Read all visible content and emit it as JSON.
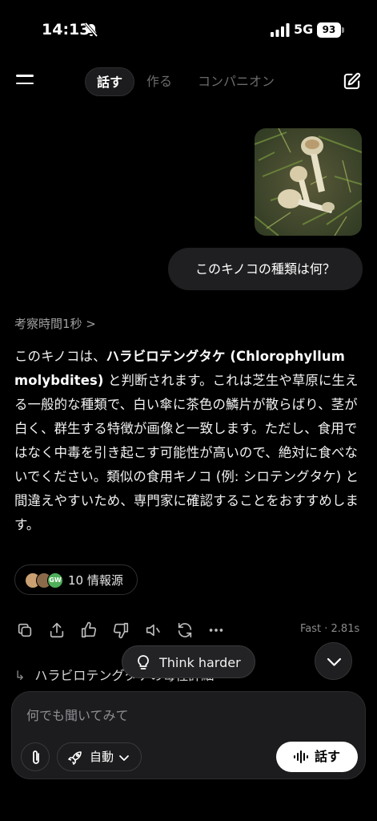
{
  "status_bar": {
    "time": "14:13",
    "network": "5G",
    "battery": "93"
  },
  "nav": {
    "tabs": [
      {
        "label": "話す",
        "active": true
      },
      {
        "label": "作る",
        "active": false
      },
      {
        "label": "コンパニオン",
        "active": false
      }
    ]
  },
  "conversation": {
    "user_message": "このキノコの種類は何？",
    "thought_label": "考察時間1秒 >",
    "answer": {
      "intro": "このキノコは、",
      "name_bold": "ハラビロテングタケ (Chlorophyllum molybdites)",
      "body": " と判断されます。これは芝生や草原に生える一般的な種類で、白い傘に茶色の鱗片が散らばり、茎が白く、群生する特徴が画像と一致します。ただし、食用ではなく中毒を引き起こす可能性が高いので、絶対に食べないでください。類似の食用キノコ (例: シロテングタケ) と間違えやすいため、専門家に確認することをおすすめします。"
    },
    "sources_label": "10 情報源",
    "source_badge": "GW",
    "timing": "Fast · 2.81s",
    "followup": "ハラビロテングタケの毒性詳細"
  },
  "overlay": {
    "think_harder": "Think harder"
  },
  "composer": {
    "placeholder": "何でも聞いてみて",
    "mode_label": "自動",
    "talk_label": "話す"
  },
  "colors": {
    "background": "#000000",
    "bubble": "#1f1f21",
    "muted": "#8e8e93"
  }
}
